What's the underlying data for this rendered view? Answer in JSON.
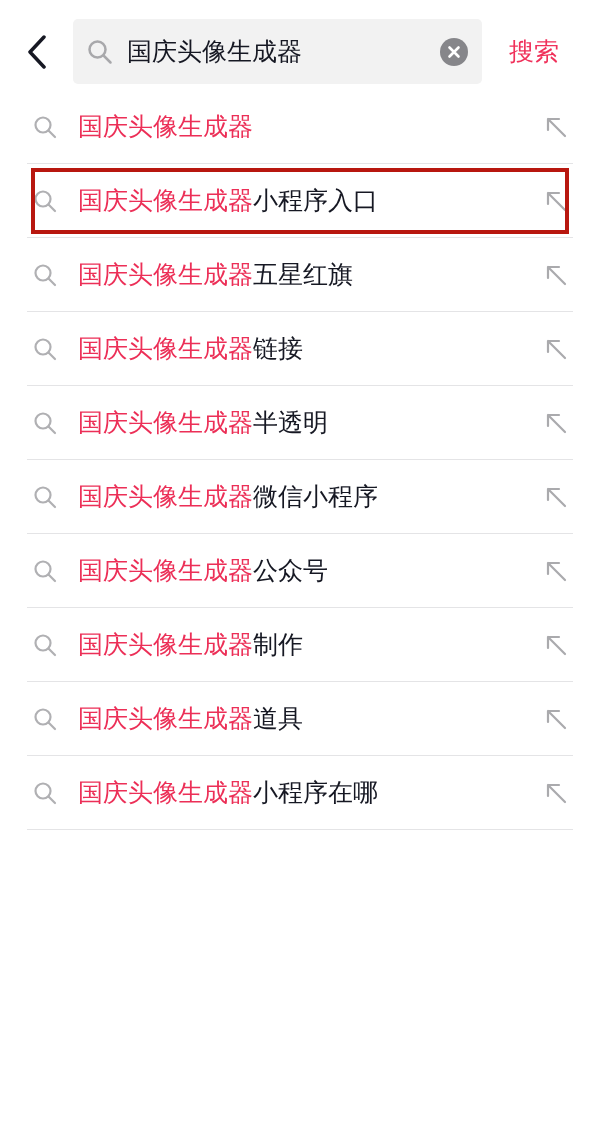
{
  "search": {
    "value": "国庆头像生成器",
    "button": "搜索"
  },
  "suggestions": [
    {
      "match": "国庆头像生成器",
      "highlighted": false
    },
    {
      "match": "国庆头像生成器",
      "rest": "小程序入口",
      "highlighted": true
    },
    {
      "match": "国庆头像生成器",
      "rest": "五星红旗",
      "highlighted": false
    },
    {
      "match": "国庆头像生成器",
      "rest": "链接",
      "highlighted": false
    },
    {
      "match": "国庆头像生成器",
      "rest": "半透明",
      "highlighted": false
    },
    {
      "match": "国庆头像生成器",
      "rest": "微信小程序",
      "highlighted": false
    },
    {
      "match": "国庆头像生成器",
      "rest": "公众号",
      "highlighted": false
    },
    {
      "match": "国庆头像生成器",
      "rest": "制作",
      "highlighted": false
    },
    {
      "match": "国庆头像生成器",
      "rest": "道具",
      "highlighted": false
    },
    {
      "match": "国庆头像生成器",
      "rest": "小程序在哪",
      "highlighted": false
    }
  ]
}
